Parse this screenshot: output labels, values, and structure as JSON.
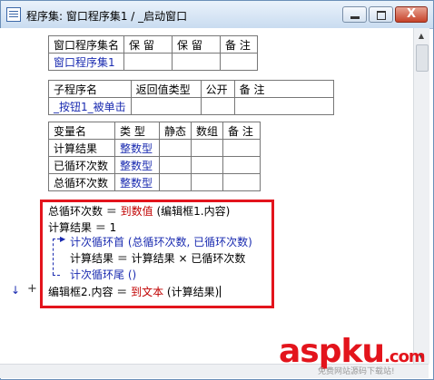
{
  "window": {
    "title": "程序集: 窗口程序集1 / _启动窗口",
    "close_label": "X"
  },
  "assembly_table": {
    "headers": [
      "窗口程序集名",
      "保 留",
      "保 留",
      "备 注"
    ],
    "row": [
      "窗口程序集1",
      "",
      "",
      ""
    ]
  },
  "sub_table": {
    "headers": [
      "子程序名",
      "返回值类型",
      "公开",
      "备 注"
    ],
    "row": [
      "_按钮1_被单击",
      "",
      "",
      ""
    ]
  },
  "var_table": {
    "headers": [
      "变量名",
      "类 型",
      "静态",
      "数组",
      "备 注"
    ],
    "rows": [
      [
        "计算结果",
        "整数型",
        "",
        "",
        ""
      ],
      [
        "已循环次数",
        "整数型",
        "",
        "",
        ""
      ],
      [
        "总循环次数",
        "整数型",
        "",
        "",
        ""
      ]
    ]
  },
  "code": {
    "l1a": "总循环次数 ＝ ",
    "l1b": "到数值",
    "l1c": " (编辑框1.内容)",
    "l2": "计算结果 ＝ 1",
    "l3": "计次循环首 (总循环次数, 已循环次数)",
    "l4": "计算结果 ＝ 计算结果 × 已循环次数",
    "l5": "计次循环尾 ()",
    "l6a": "编辑框2.内容 ＝ ",
    "l6b": "到文本",
    "l6c": " (计算结果)"
  },
  "gutter": {
    "arrow": "↓",
    "plus": "+"
  },
  "watermark": {
    "brand": "aspku",
    "suffix": ".com",
    "sub": "免费网站源码下载站!"
  },
  "colors": {
    "highlight_border": "#e3141c",
    "keyword_red": "#c00000",
    "type_blue": "#1a2bb0"
  }
}
